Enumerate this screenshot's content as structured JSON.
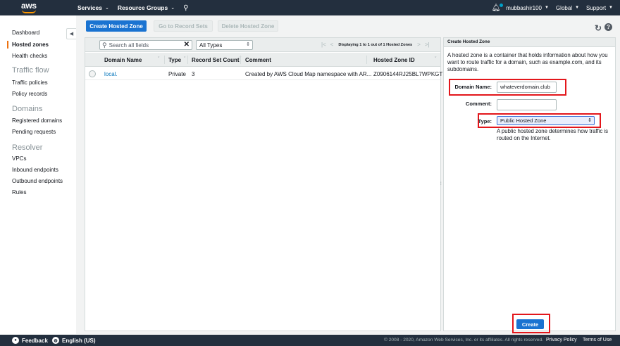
{
  "topnav": {
    "logo": "aws",
    "services": "Services",
    "resource_groups": "Resource Groups",
    "account": "mubbashir100",
    "region": "Global",
    "support": "Support"
  },
  "sidebar": {
    "items": [
      {
        "label": "Dashboard"
      },
      {
        "label": "Hosted zones"
      },
      {
        "label": "Health checks"
      }
    ],
    "traffic_flow": {
      "heading": "Traffic flow",
      "items": [
        {
          "label": "Traffic policies"
        },
        {
          "label": "Policy records"
        }
      ]
    },
    "domains": {
      "heading": "Domains",
      "items": [
        {
          "label": "Registered domains"
        },
        {
          "label": "Pending requests"
        }
      ]
    },
    "resolver": {
      "heading": "Resolver",
      "items": [
        {
          "label": "VPCs"
        },
        {
          "label": "Inbound endpoints"
        },
        {
          "label": "Outbound endpoints"
        },
        {
          "label": "Rules"
        }
      ]
    }
  },
  "toolbar": {
    "create_hosted_zone": "Create Hosted Zone",
    "go_to_record_sets": "Go to Record Sets",
    "delete_hosted_zone": "Delete Hosted Zone"
  },
  "filter": {
    "search_placeholder": "Search all fields",
    "type_filter": "All Types",
    "pagination": "Displaying 1 to 1 out of 1 Hosted Zones"
  },
  "table": {
    "columns": [
      "Domain Name",
      "Type",
      "Record Set Count",
      "Comment",
      "Hosted Zone ID"
    ],
    "rows": [
      {
        "domain_name": "local.",
        "type": "Private",
        "record_set_count": "3",
        "comment": "Created by AWS Cloud Map namespace with AR...",
        "hosted_zone_id": "Z0906144RJ25BL7WPKGT"
      }
    ]
  },
  "panel": {
    "title": "Create Hosted Zone",
    "description": "A hosted zone is a container that holds information about how you want to route traffic for a domain, such as example.com, and its subdomains.",
    "domain_name_label": "Domain Name:",
    "domain_name_value": "whateverdomain.club",
    "comment_label": "Comment:",
    "comment_value": "",
    "type_label": "Type:",
    "type_value": "Public Hosted Zone",
    "type_help": "A public hosted zone determines how traffic is routed on the Internet.",
    "create_button": "Create"
  },
  "footer": {
    "feedback": "Feedback",
    "language": "English (US)",
    "copyright": "© 2008 - 2020, Amazon Web Services, Inc. or its affiliates. All rights reserved.",
    "privacy": "Privacy Policy",
    "terms": "Terms of Use"
  },
  "colors": {
    "nav_bg": "#232f3e",
    "primary_button": "#1a73d1",
    "active_bar": "#ec7211",
    "highlight": "#e3161b",
    "link": "#0073bb"
  }
}
